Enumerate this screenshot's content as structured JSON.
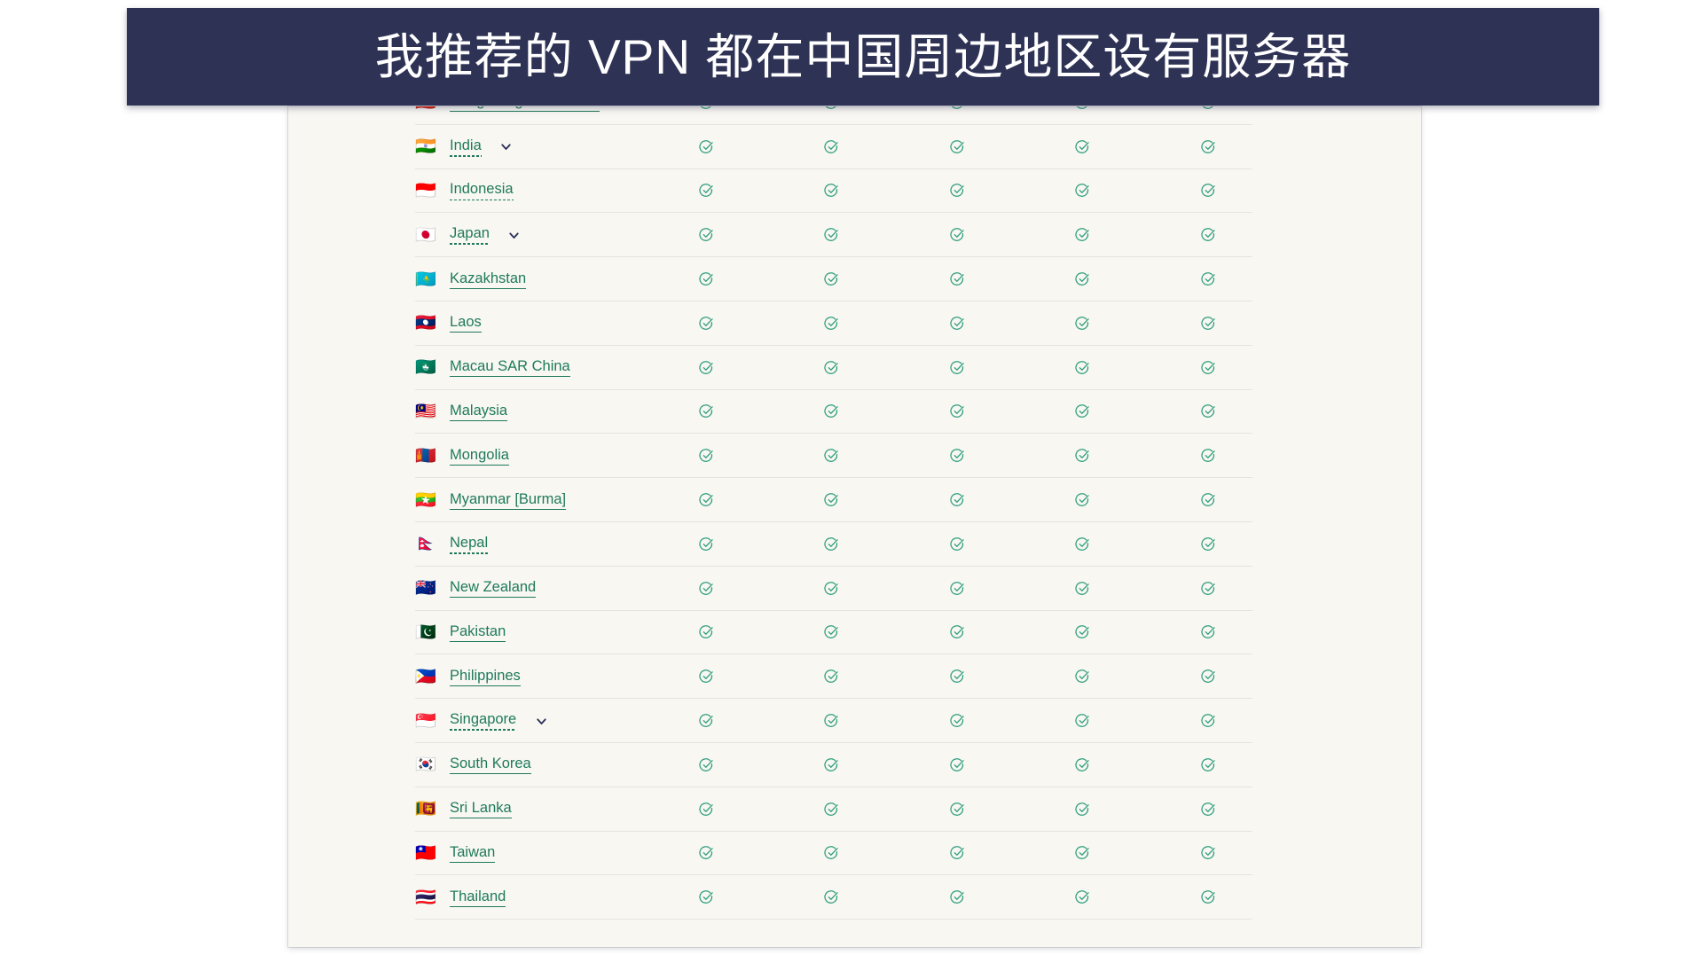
{
  "banner": {
    "text": "我推荐的 VPN 都在中国周边地区设有服务器",
    "background_color": "#2e3254",
    "text_color": "#ffffff"
  },
  "colors": {
    "page_background": "#ffffff",
    "card_background": "#f8f7f2",
    "link_green": "#1f7a5c",
    "check_green": "#2f9e7e",
    "chevron_navy": "#2b2f55",
    "row_divider": "#e6e4dd"
  },
  "table": {
    "check_columns": 5,
    "check_icon": "check-circle-icon",
    "expand_icon": "chevron-down-icon",
    "rows": [
      {
        "flag": "🇭🇰",
        "name": "Hong Kong SAR China",
        "underline": "solid",
        "expandable": true,
        "checks": [
          true,
          true,
          true,
          true,
          true
        ]
      },
      {
        "flag": "🇮🇳",
        "name": "India",
        "underline": "dotted",
        "expandable": true,
        "checks": [
          true,
          true,
          true,
          true,
          true
        ]
      },
      {
        "flag": "🇮🇩",
        "name": "Indonesia",
        "underline": "dotted",
        "expandable": false,
        "checks": [
          true,
          true,
          true,
          true,
          true
        ]
      },
      {
        "flag": "🇯🇵",
        "name": "Japan",
        "underline": "dotted",
        "expandable": true,
        "checks": [
          true,
          true,
          true,
          true,
          true
        ]
      },
      {
        "flag": "🇰🇿",
        "name": "Kazakhstan",
        "underline": "solid",
        "expandable": false,
        "checks": [
          true,
          true,
          true,
          true,
          true
        ]
      },
      {
        "flag": "🇱🇦",
        "name": "Laos",
        "underline": "solid",
        "expandable": false,
        "checks": [
          true,
          true,
          true,
          true,
          true
        ]
      },
      {
        "flag": "🇲🇴",
        "name": "Macau SAR China",
        "underline": "solid",
        "expandable": false,
        "checks": [
          true,
          true,
          true,
          true,
          true
        ]
      },
      {
        "flag": "🇲🇾",
        "name": "Malaysia",
        "underline": "solid",
        "expandable": false,
        "checks": [
          true,
          true,
          true,
          true,
          true
        ]
      },
      {
        "flag": "🇲🇳",
        "name": "Mongolia",
        "underline": "solid",
        "expandable": false,
        "checks": [
          true,
          true,
          true,
          true,
          true
        ]
      },
      {
        "flag": "🇲🇲",
        "name": "Myanmar [Burma]",
        "underline": "solid",
        "expandable": false,
        "checks": [
          true,
          true,
          true,
          true,
          true
        ]
      },
      {
        "flag": "🇳🇵",
        "name": "Nepal",
        "underline": "dotted",
        "expandable": false,
        "checks": [
          true,
          true,
          true,
          true,
          true
        ]
      },
      {
        "flag": "🇳🇿",
        "name": "New Zealand",
        "underline": "solid",
        "expandable": false,
        "checks": [
          true,
          true,
          true,
          true,
          true
        ]
      },
      {
        "flag": "🇵🇰",
        "name": "Pakistan",
        "underline": "solid",
        "expandable": false,
        "checks": [
          true,
          true,
          true,
          true,
          true
        ]
      },
      {
        "flag": "🇵🇭",
        "name": "Philippines",
        "underline": "solid",
        "expandable": false,
        "checks": [
          true,
          true,
          true,
          true,
          true
        ]
      },
      {
        "flag": "🇸🇬",
        "name": "Singapore",
        "underline": "dotted",
        "expandable": true,
        "checks": [
          true,
          true,
          true,
          true,
          true
        ]
      },
      {
        "flag": "🇰🇷",
        "name": "South Korea",
        "underline": "solid",
        "expandable": false,
        "checks": [
          true,
          true,
          true,
          true,
          true
        ]
      },
      {
        "flag": "🇱🇰",
        "name": "Sri Lanka",
        "underline": "solid",
        "expandable": false,
        "checks": [
          true,
          true,
          true,
          true,
          true
        ]
      },
      {
        "flag": "🇹🇼",
        "name": "Taiwan",
        "underline": "solid",
        "expandable": false,
        "checks": [
          true,
          true,
          true,
          true,
          true
        ]
      },
      {
        "flag": "🇹🇭",
        "name": "Thailand",
        "underline": "solid",
        "expandable": false,
        "checks": [
          true,
          true,
          true,
          true,
          true
        ]
      }
    ]
  }
}
